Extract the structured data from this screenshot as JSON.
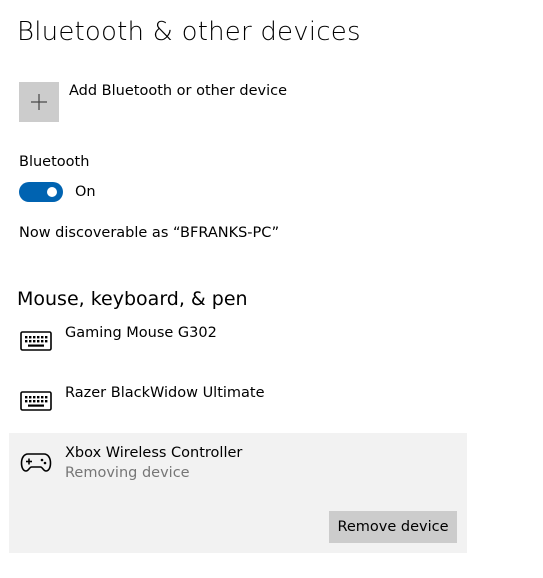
{
  "page": {
    "title": "Bluetooth & other devices"
  },
  "add_device": {
    "label": "Add Bluetooth or other device",
    "icon": "plus-icon"
  },
  "bluetooth": {
    "label": "Bluetooth",
    "toggle_state": "On",
    "enabled": true,
    "discoverable_text": "Now discoverable as “BFRANKS-PC”"
  },
  "section": {
    "title": "Mouse, keyboard, & pen"
  },
  "devices": [
    {
      "name": "Gaming Mouse G302",
      "icon": "keyboard-icon",
      "status": ""
    },
    {
      "name": "Razer BlackWidow Ultimate",
      "icon": "keyboard-icon",
      "status": ""
    },
    {
      "name": "Xbox Wireless Controller",
      "icon": "gamepad-icon",
      "status": "Removing device",
      "selected": true
    }
  ],
  "actions": {
    "remove_label": "Remove device"
  },
  "colors": {
    "accent": "#0063b1",
    "selected_bg": "#f2f2f2",
    "tile_bg": "#cccccc",
    "secondary_text": "#767676"
  }
}
